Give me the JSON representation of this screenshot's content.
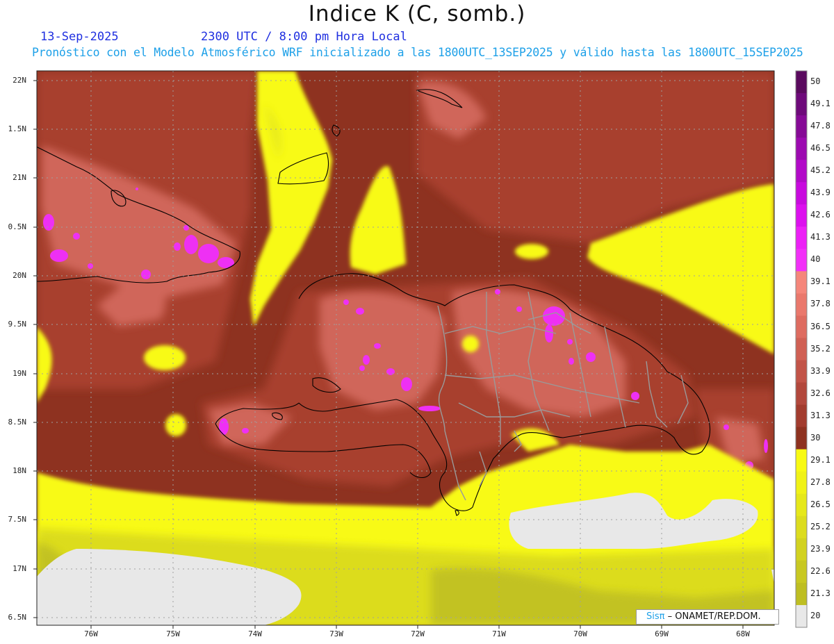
{
  "header": {
    "title": "Indice K (C, somb.)",
    "date": "13-Sep-2025",
    "time": "2300 UTC / 8:00 pm Hora Local",
    "description": "Pronóstico con el Modelo Atmosférico WRF inicializado a las 1800UTC_13SEP2025 y válido hasta las  1800UTC_15SEP2025"
  },
  "map": {
    "lat_labels": [
      "22N",
      "1.5N",
      "21N",
      "0.5N",
      "20N",
      "9.5N",
      "19N",
      "8.5N",
      "18N",
      "7.5N",
      "17N",
      "6.5N"
    ],
    "lon_labels": [
      "76W",
      "75W",
      "74W",
      "73W",
      "72W",
      "71W",
      "70W",
      "69W",
      "68W"
    ]
  },
  "colorbar": {
    "labels": [
      "50",
      "49.1",
      "47.8",
      "46.5",
      "45.2",
      "43.9",
      "42.6",
      "41.3",
      "40",
      "39.1",
      "37.8",
      "36.5",
      "35.2",
      "33.9",
      "32.6",
      "31.3",
      "30",
      "29.1",
      "27.8",
      "26.5",
      "25.2",
      "23.9",
      "22.6",
      "21.3",
      "20"
    ],
    "colors": [
      "#5a0a5e",
      "#6e0a7a",
      "#860a96",
      "#9c0ab0",
      "#b20ac8",
      "#c80ade",
      "#dc10ee",
      "#ec20f6",
      "#f230f8",
      "#f5867a",
      "#ea786c",
      "#de6c60",
      "#d06054",
      "#c25448",
      "#b2483c",
      "#a23c2e",
      "#8e3220",
      "#f8fa12",
      "#f0f216",
      "#e6e81a",
      "#dcdc1e",
      "#d2d220",
      "#c8c822",
      "#bebe22",
      "#e8e8e8"
    ]
  },
  "credit": {
    "brand": "Sisπ",
    "text": "– ONAMET/REP.DOM."
  }
}
